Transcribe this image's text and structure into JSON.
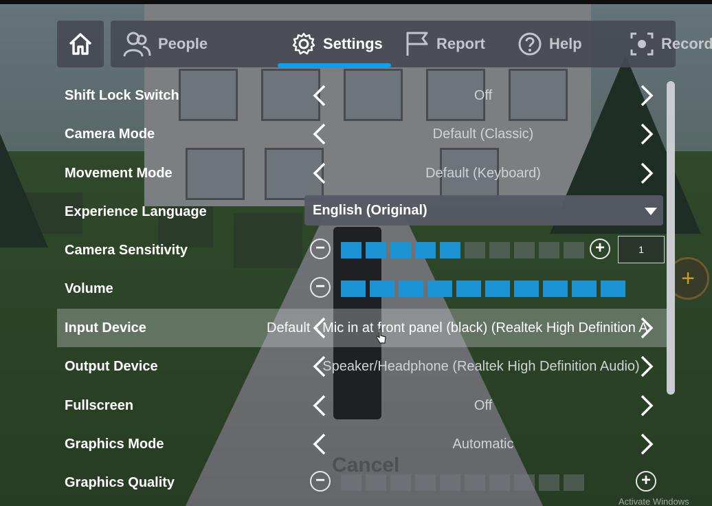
{
  "nav": {
    "tabs": [
      {
        "label": "People",
        "icon": "people-icon"
      },
      {
        "label": "Settings",
        "icon": "gear-icon"
      },
      {
        "label": "Report",
        "icon": "flag-icon"
      },
      {
        "label": "Help",
        "icon": "help-icon"
      },
      {
        "label": "Record",
        "icon": "record-icon"
      }
    ],
    "active_tab": "Settings",
    "accent_color": "#00a2ff"
  },
  "settings": {
    "shift_lock": {
      "label": "Shift Lock Switch",
      "value": "Off"
    },
    "camera_mode": {
      "label": "Camera Mode",
      "value": "Default (Classic)"
    },
    "movement_mode": {
      "label": "Movement Mode",
      "value": "Default (Keyboard)"
    },
    "language": {
      "label": "Experience Language",
      "value": "English (Original)"
    },
    "camera_sensitivity": {
      "label": "Camera Sensitivity",
      "level": 5,
      "segments": 10,
      "value_box": "1"
    },
    "volume": {
      "label": "Volume",
      "level": 10,
      "segments": 10
    },
    "input_device": {
      "label": "Input Device",
      "value": "Default - Mic in at front panel (black) (Realtek High Definition A"
    },
    "output_device": {
      "label": "Output Device",
      "value": "Speaker/Headphone (Realtek High Definition Audio)"
    },
    "fullscreen": {
      "label": "Fullscreen",
      "value": "Off"
    },
    "graphics_mode": {
      "label": "Graphics Mode",
      "value": "Automatic"
    },
    "graphics_quality": {
      "label": "Graphics Quality",
      "level": 0,
      "segments": 10
    }
  },
  "background": {
    "cancel_text": "Cancel",
    "watermark": "Activate Windows"
  }
}
